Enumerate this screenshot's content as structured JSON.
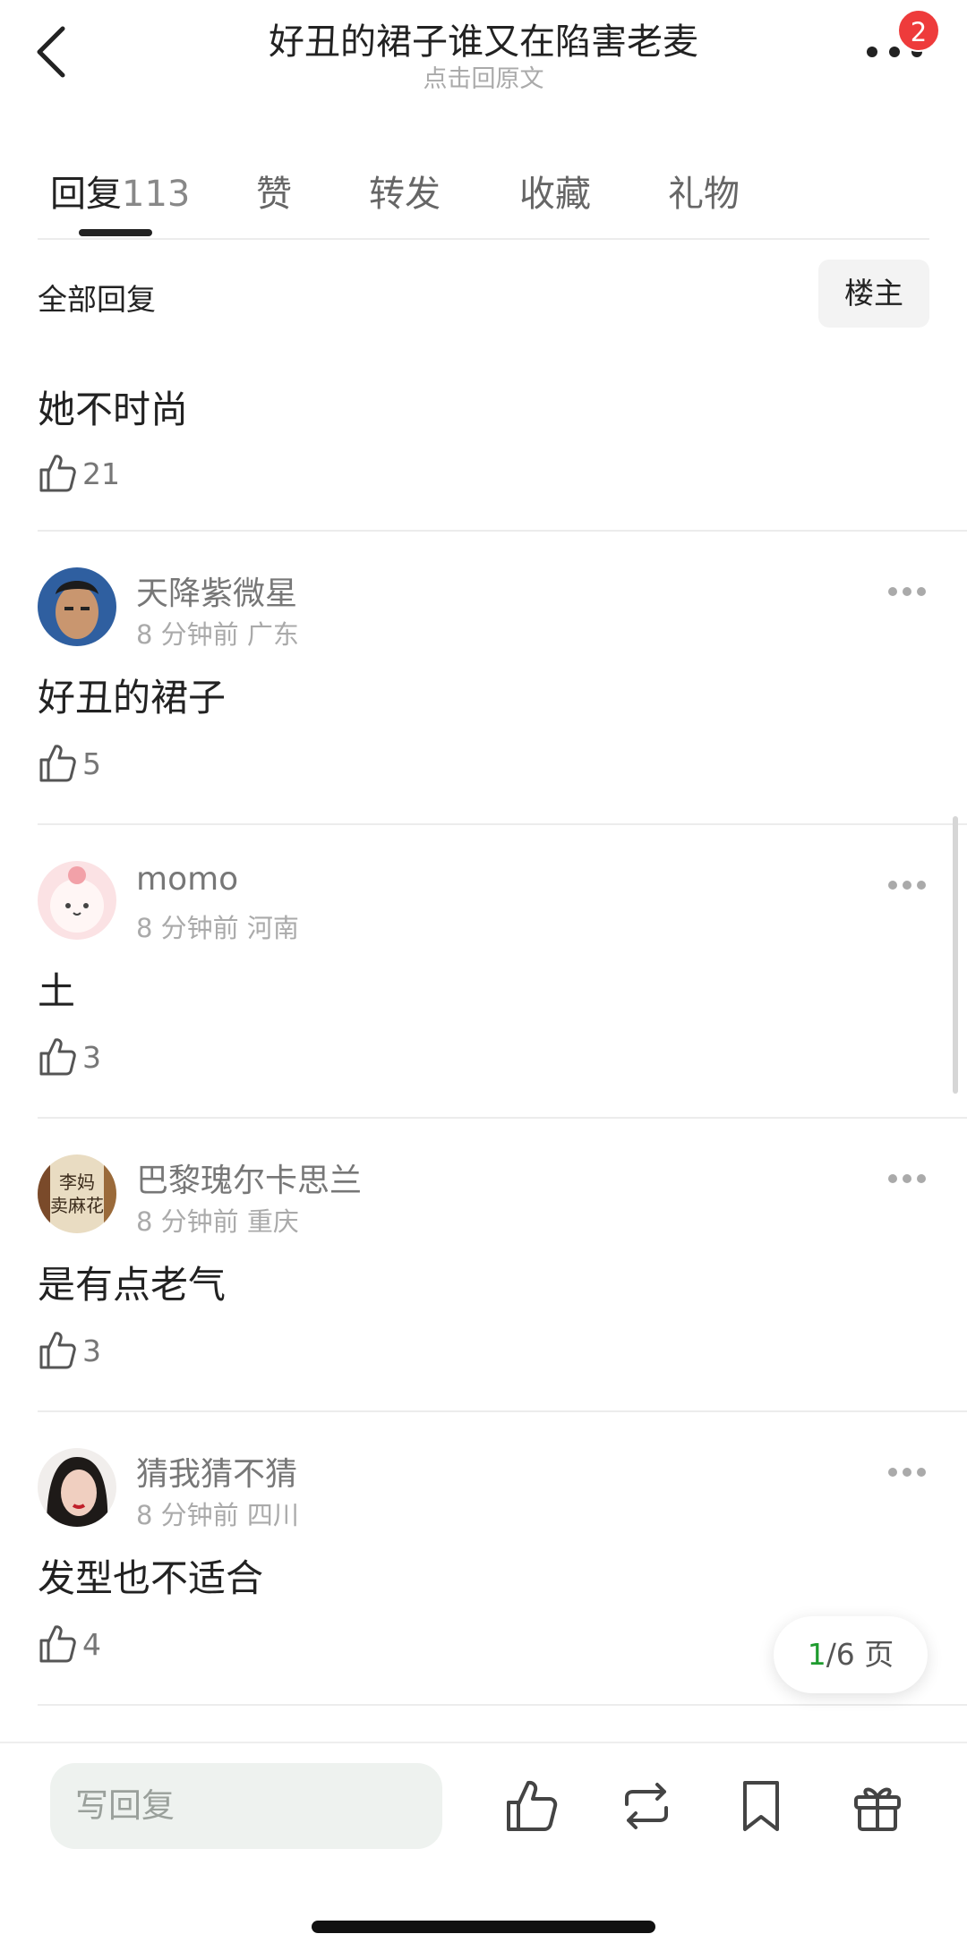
{
  "header": {
    "title": "好丑的裙子谁又在陷害老麦",
    "subtitle": "点击回原文",
    "badge_count": "2"
  },
  "tabs": [
    {
      "label": "回复",
      "count": "113"
    },
    {
      "label": "赞"
    },
    {
      "label": "转发"
    },
    {
      "label": "收藏"
    },
    {
      "label": "礼物"
    }
  ],
  "filter": {
    "label": "全部回复",
    "owner_button": "楼主"
  },
  "comments": [
    {
      "username": "",
      "meta": "",
      "content": "她不时尚",
      "likes": "21"
    },
    {
      "username": "天降紫微星",
      "meta": "8 分钟前 广东",
      "content": "好丑的裙子",
      "likes": "5"
    },
    {
      "username": "momo",
      "meta": "8 分钟前 河南",
      "content": "土",
      "likes": "3"
    },
    {
      "username": "巴黎瑰尔卡思兰",
      "meta": "8 分钟前 重庆",
      "content": "是有点老气",
      "likes": "3"
    },
    {
      "username": "猜我猜不猜",
      "meta": "8 分钟前 四川",
      "content": "发型也不适合",
      "likes": "4"
    }
  ],
  "pager": {
    "current": "1",
    "total": "/6 页"
  },
  "bottom_bar": {
    "reply_placeholder": "写回复",
    "icons": [
      "like-icon",
      "repost-icon",
      "bookmark-icon",
      "gift-icon"
    ]
  },
  "avatar_text": {
    "stamp": "李妈卖麻花"
  },
  "colors": {
    "accent_green": "#1e9b2e",
    "badge_red": "#ee3b3b"
  }
}
